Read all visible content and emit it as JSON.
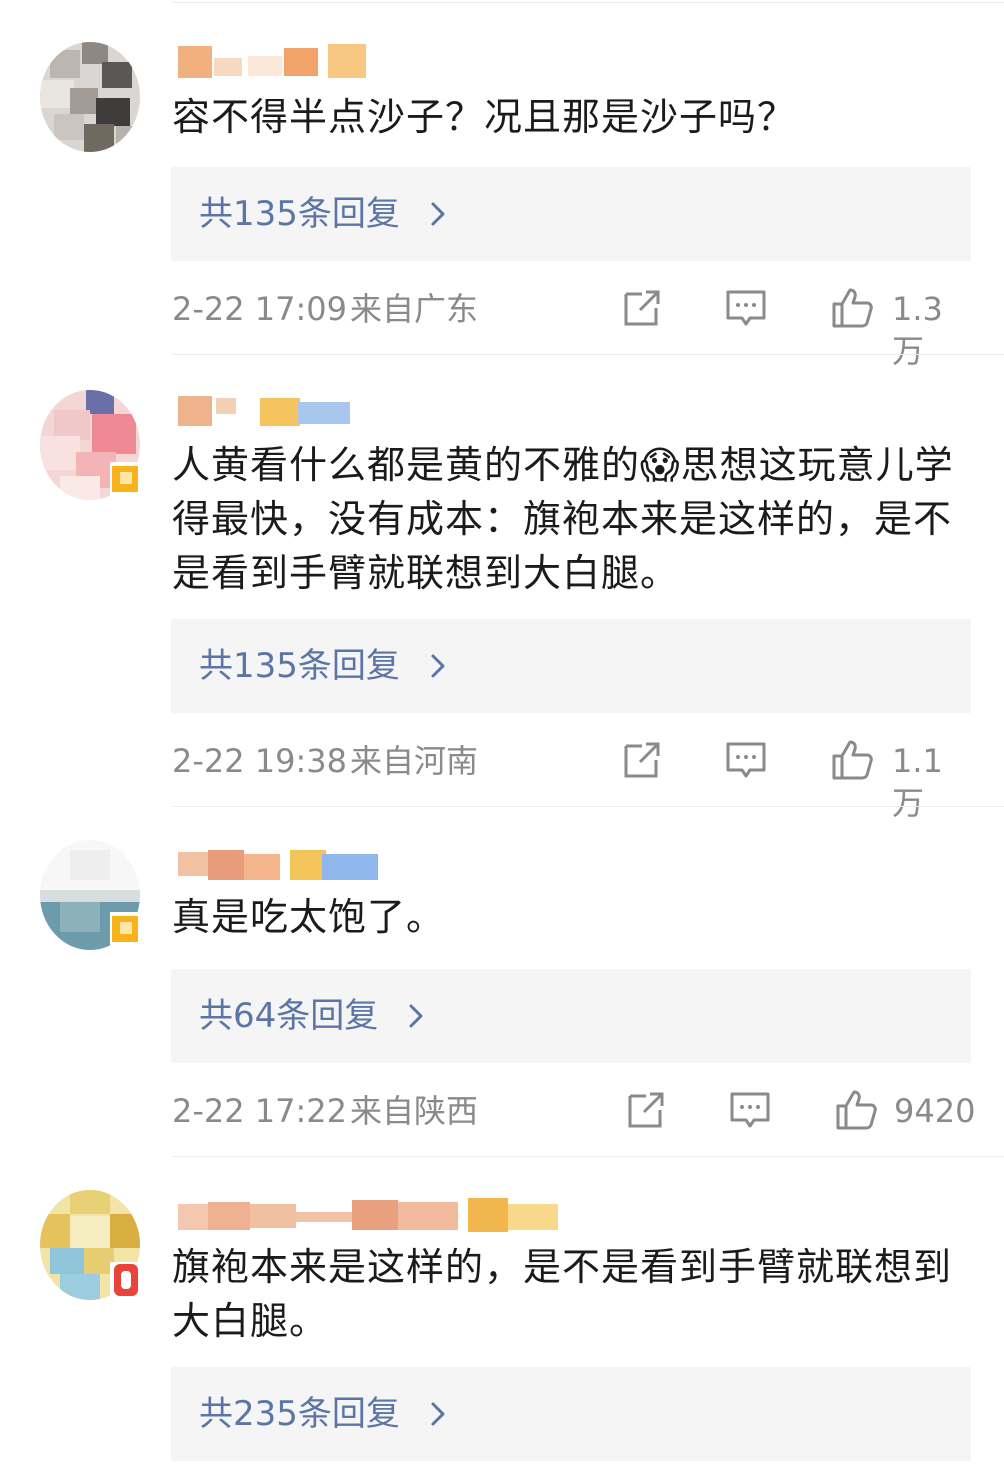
{
  "comments": [
    {
      "text": "容不得半点沙子？况且那是沙子吗？",
      "replies": "共135条回复",
      "time": "2-22 17:09",
      "location": "来自广东",
      "likes": "1.3万"
    },
    {
      "text": "人黄看什么都是黄的不雅的😱思想这玩意儿学得最快，没有成本：旗袍本来是这样的，是不是看到手臂就联想到大白腿。",
      "replies": "共135条回复",
      "time": "2-22 19:38",
      "location": "来自河南",
      "likes": "1.1万"
    },
    {
      "text": "真是吃太饱了。",
      "replies": "共64条回复",
      "time": "2-22 17:22",
      "location": "来自陕西",
      "likes": "9420"
    },
    {
      "text": "旗袍本来是这样的，是不是看到手臂就联想到大白腿。",
      "replies": "共235条回复"
    }
  ],
  "colors": {
    "reply_link": "#5b76a6",
    "meta_gray": "#8a8a8a",
    "reply_bg": "#f5f5f5"
  },
  "icons": {
    "share": "share-icon",
    "comment": "comment-icon",
    "like": "thumbs-up-icon",
    "chevron": "chevron-right-icon"
  }
}
